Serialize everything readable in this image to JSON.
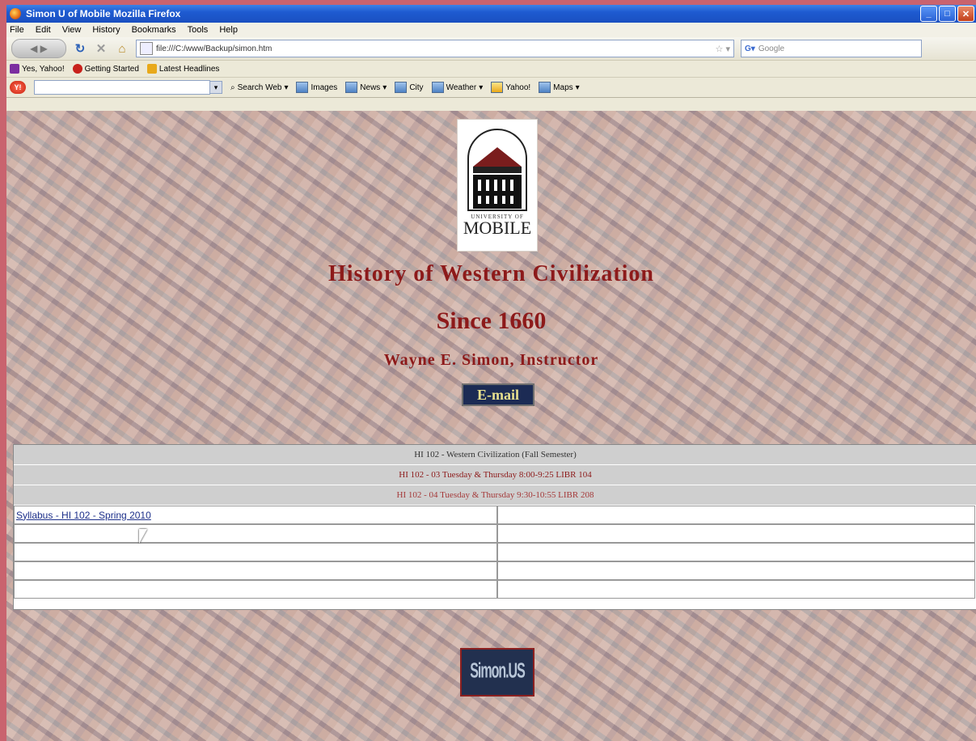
{
  "window": {
    "title": "Simon U of Mobile Mozilla Firefox"
  },
  "menu": [
    "File",
    "Edit",
    "View",
    "History",
    "Bookmarks",
    "Tools",
    "Help"
  ],
  "nav": {
    "url": "file:///C:/www/Backup/simon.htm",
    "search_placeholder": "Google"
  },
  "bookmarks": [
    {
      "label": "Yes, Yahoo!",
      "color": "#7b2ea0"
    },
    {
      "label": "Getting Started",
      "color": "#c8211b"
    },
    {
      "label": "Latest Headlines",
      "color": "#e8a91a"
    }
  ],
  "yahoo_toolbar": {
    "badge": "Y!",
    "items": [
      "Search Web",
      "Images",
      "News",
      "City",
      "Weather",
      "Yahoo!",
      "Maps"
    ]
  },
  "page": {
    "logo_text_top": "UNIVERSITY OF",
    "logo_text_bottom": "MOBILE",
    "title_line1": "History of Western Civilization",
    "title_line2": "Since 1660",
    "instructor": "Wayne E. Simon, Instructor",
    "email_label": "E-mail",
    "table": {
      "header_rows": [
        "HI 102 - Western Civilization (Fall Semester)",
        "HI 102 - 03 Tuesday & Thursday 8:00-9:25 LIBR 104",
        "HI 102 - 04 Tuesday & Thursday 9:30-10:55 LIBR 208"
      ],
      "rows": [
        [
          "Syllabus - HI 102 - Spring 2010",
          ""
        ],
        [
          "",
          ""
        ],
        [
          "",
          ""
        ],
        [
          "",
          ""
        ],
        [
          "",
          ""
        ]
      ]
    },
    "badge_text": "Simon.US"
  },
  "colors": {
    "title_red": "#8d1a1a",
    "link_blue": "#1c2f8a",
    "page_border": "#c9636e"
  }
}
